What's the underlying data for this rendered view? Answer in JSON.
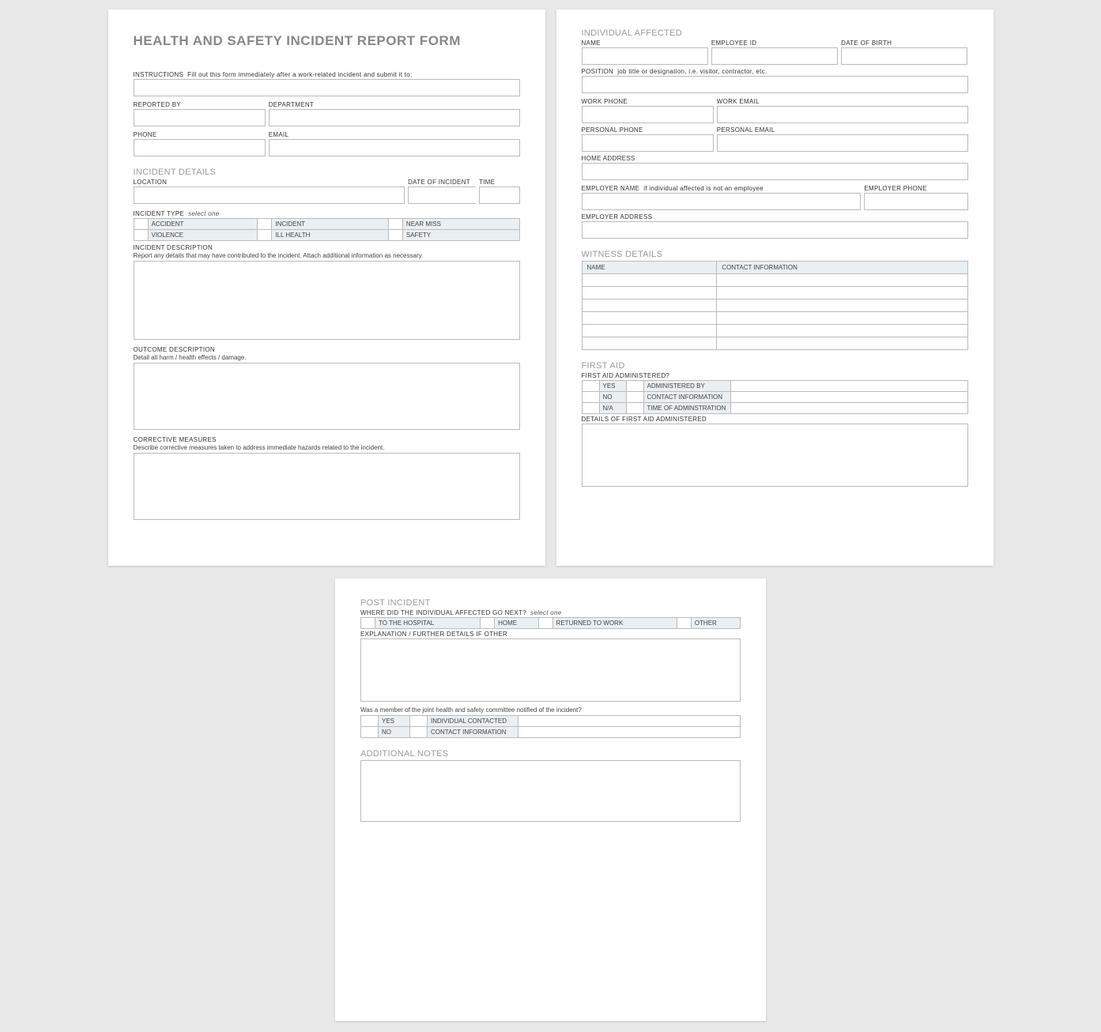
{
  "title": "HEALTH AND SAFETY INCIDENT REPORT FORM",
  "instructions_label": "INSTRUCTIONS",
  "instructions_text": "Fill out this form immediately after a work-related incident and submit it to:",
  "fields": {
    "reported_by": "REPORTED BY",
    "department": "DEPARTMENT",
    "phone": "PHONE",
    "email": "EMAIL"
  },
  "incident": {
    "head": "INCIDENT DETAILS",
    "location": "LOCATION",
    "date": "DATE OF INCIDENT",
    "time": "TIME",
    "type_label": "INCIDENT TYPE",
    "type_hint": "select one",
    "types": {
      "accident": "ACCIDENT",
      "incident": "INCIDENT",
      "near_miss": "NEAR MISS",
      "violence": "VIOLENCE",
      "ill_health": "ILL HEALTH",
      "safety": "SAFETY"
    },
    "desc_label": "INCIDENT DESCRIPTION",
    "desc_sub": "Report any details that may have contributed to the incident.  Attach additional information as necessary.",
    "outcome_label": "OUTCOME DESCRIPTION",
    "outcome_sub": "Detail all harm / health effects / damage.",
    "corrective_label": "CORRECTIVE MEASURES",
    "corrective_sub": "Describe corrective measures taken to address immediate hazards related to the incident."
  },
  "individual": {
    "head": "INDIVIDUAL AFFECTED",
    "name": "NAME",
    "employee_id": "EMPLOYEE ID",
    "dob": "DATE OF BIRTH",
    "position_label": "POSITION",
    "position_hint": "job title or designation, i.e. visitor, contractor, etc.",
    "work_phone": "WORK PHONE",
    "work_email": "WORK EMAIL",
    "personal_phone": "PERSONAL PHONE",
    "personal_email": "PERSONAL EMAIL",
    "home_address": "HOME ADDRESS",
    "employer_name_label": "EMPLOYER NAME",
    "employer_name_hint": "if individual affected is not an employee",
    "employer_phone": "EMPLOYER PHONE",
    "employer_address": "EMPLOYER ADDRESS"
  },
  "witness": {
    "head": "WITNESS DETAILS",
    "col_name": "NAME",
    "col_contact": "CONTACT INFORMATION",
    "rows": 6
  },
  "firstaid": {
    "head": "FIRST AID",
    "question": "FIRST AID ADMINISTERED?",
    "yes": "YES",
    "no": "NO",
    "na": "N/A",
    "admin_by": "ADMINISTERED BY",
    "contact": "CONTACT INFORMATION",
    "time": "TIME OF ADMINSTRATION",
    "details": "DETAILS OF FIRST AID ADMINISTERED"
  },
  "post": {
    "head": "POST INCIDENT",
    "where_label": "WHERE DID THE INDIVIDUAL AFFECTED GO NEXT?",
    "where_hint": "select one",
    "opts": {
      "hospital": "TO THE HOSPITAL",
      "home": "HOME",
      "work": "RETURNED TO WORK",
      "other": "OTHER"
    },
    "explanation": "EXPLANATION / FURTHER DETAILS IF OTHER",
    "committee_q": "Was a member of the joint health and safety committee notified of the incident?",
    "yes": "YES",
    "no": "NO",
    "contacted": "INDIVIDUAL CONTACTED",
    "contact_info": "CONTACT INFORMATION"
  },
  "notes": {
    "head": "ADDITIONAL NOTES"
  }
}
